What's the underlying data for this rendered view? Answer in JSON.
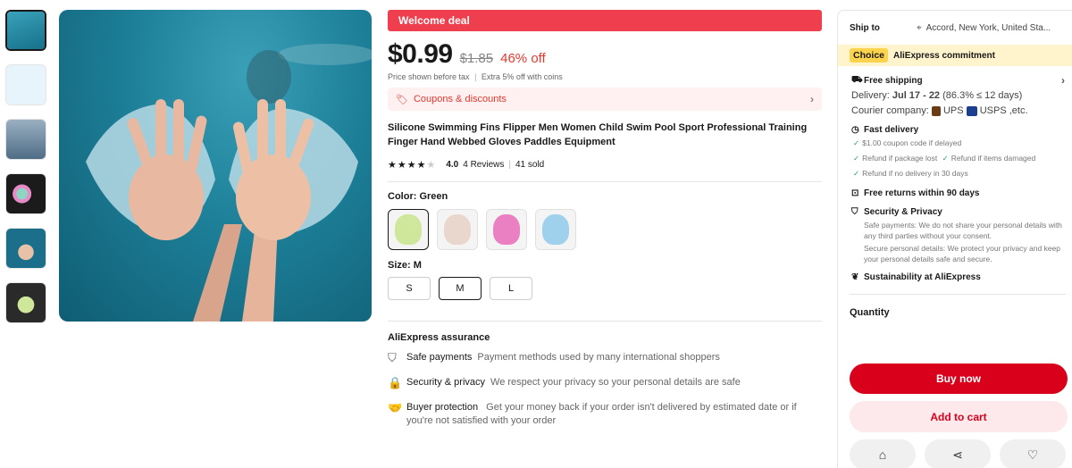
{
  "gallery": {
    "thumbnails": [
      {
        "name": "thumb-1",
        "color": "#2b88a3"
      },
      {
        "name": "thumb-2",
        "color": "#dff1fb"
      },
      {
        "name": "thumb-3",
        "color": "#7d95aa"
      },
      {
        "name": "thumb-4",
        "color": "#1f1f1f"
      },
      {
        "name": "thumb-5",
        "color": "#1c6f8a"
      },
      {
        "name": "thumb-6",
        "color": "#2a2a2a"
      }
    ]
  },
  "product": {
    "welcome_deal": "Welcome deal",
    "price": "$0.99",
    "original_price": "$1.85",
    "discount": "46% off",
    "tax_note": "Price shown before tax",
    "tax_sep": "|",
    "coins_note": "Extra 5% off with coins",
    "coupons_label": "Coupons & discounts",
    "title": "Silicone Swimming Fins Flipper Men Women Child Swim Pool Sport Professional Training Finger Hand Webbed Gloves Paddles Equipment",
    "rating": "4.0",
    "reviews": "4 Reviews",
    "rating_sep": "|",
    "sold": "41 sold",
    "color_label": "Color: Green",
    "colors": [
      {
        "name": "Green",
        "hex": "#cfe79a"
      },
      {
        "name": "White",
        "hex": "#e9e4e0"
      },
      {
        "name": "Pink",
        "hex": "#ea7fc2"
      },
      {
        "name": "Blue",
        "hex": "#9fd0ec"
      }
    ],
    "size_label": "Size: M",
    "sizes": [
      "S",
      "M",
      "L"
    ],
    "selected_size": "M"
  },
  "assurance": {
    "title": "AliExpress assurance",
    "items": [
      {
        "key": "Safe payments",
        "value": "Payment methods used by many international shoppers"
      },
      {
        "key": "Security & privacy",
        "value": "We respect your privacy so your personal details are safe"
      },
      {
        "key": "Buyer protection",
        "value": "Get your money back if your order isn't delivered by estimated date or if you're not satisfied with your order"
      }
    ]
  },
  "panel": {
    "ship_to_label": "Ship to",
    "ship_to_value": "Accord, New York, United Sta...",
    "choice_badge": "Choice",
    "choice_text": "AliExpress commitment",
    "free_shipping": "Free shipping",
    "delivery_label": "Delivery:",
    "delivery_dates": "Jul 17 - 22",
    "delivery_stat": "(86.3% ≤ 12 days)",
    "courier_label": "Courier company:",
    "courier_ups": "UPS",
    "courier_usps": "USPS ,etc.",
    "fast_delivery": "Fast delivery",
    "fast_items": [
      "$1.00 coupon code if delayed",
      "Refund if package lost",
      "Refund if items damaged",
      "Refund if no delivery in 30 days"
    ],
    "free_returns": "Free returns within 90 days",
    "security_title": "Security & Privacy",
    "security_text_1": "Safe payments: We do not share your personal details with any third parties without your consent.",
    "security_text_2": "Secure personal details: We protect your privacy and keep your personal details safe and secure.",
    "sustainability": "Sustainability at AliExpress",
    "quantity_label": "Quantity",
    "buy_now": "Buy now",
    "add_to_cart": "Add to cart"
  }
}
